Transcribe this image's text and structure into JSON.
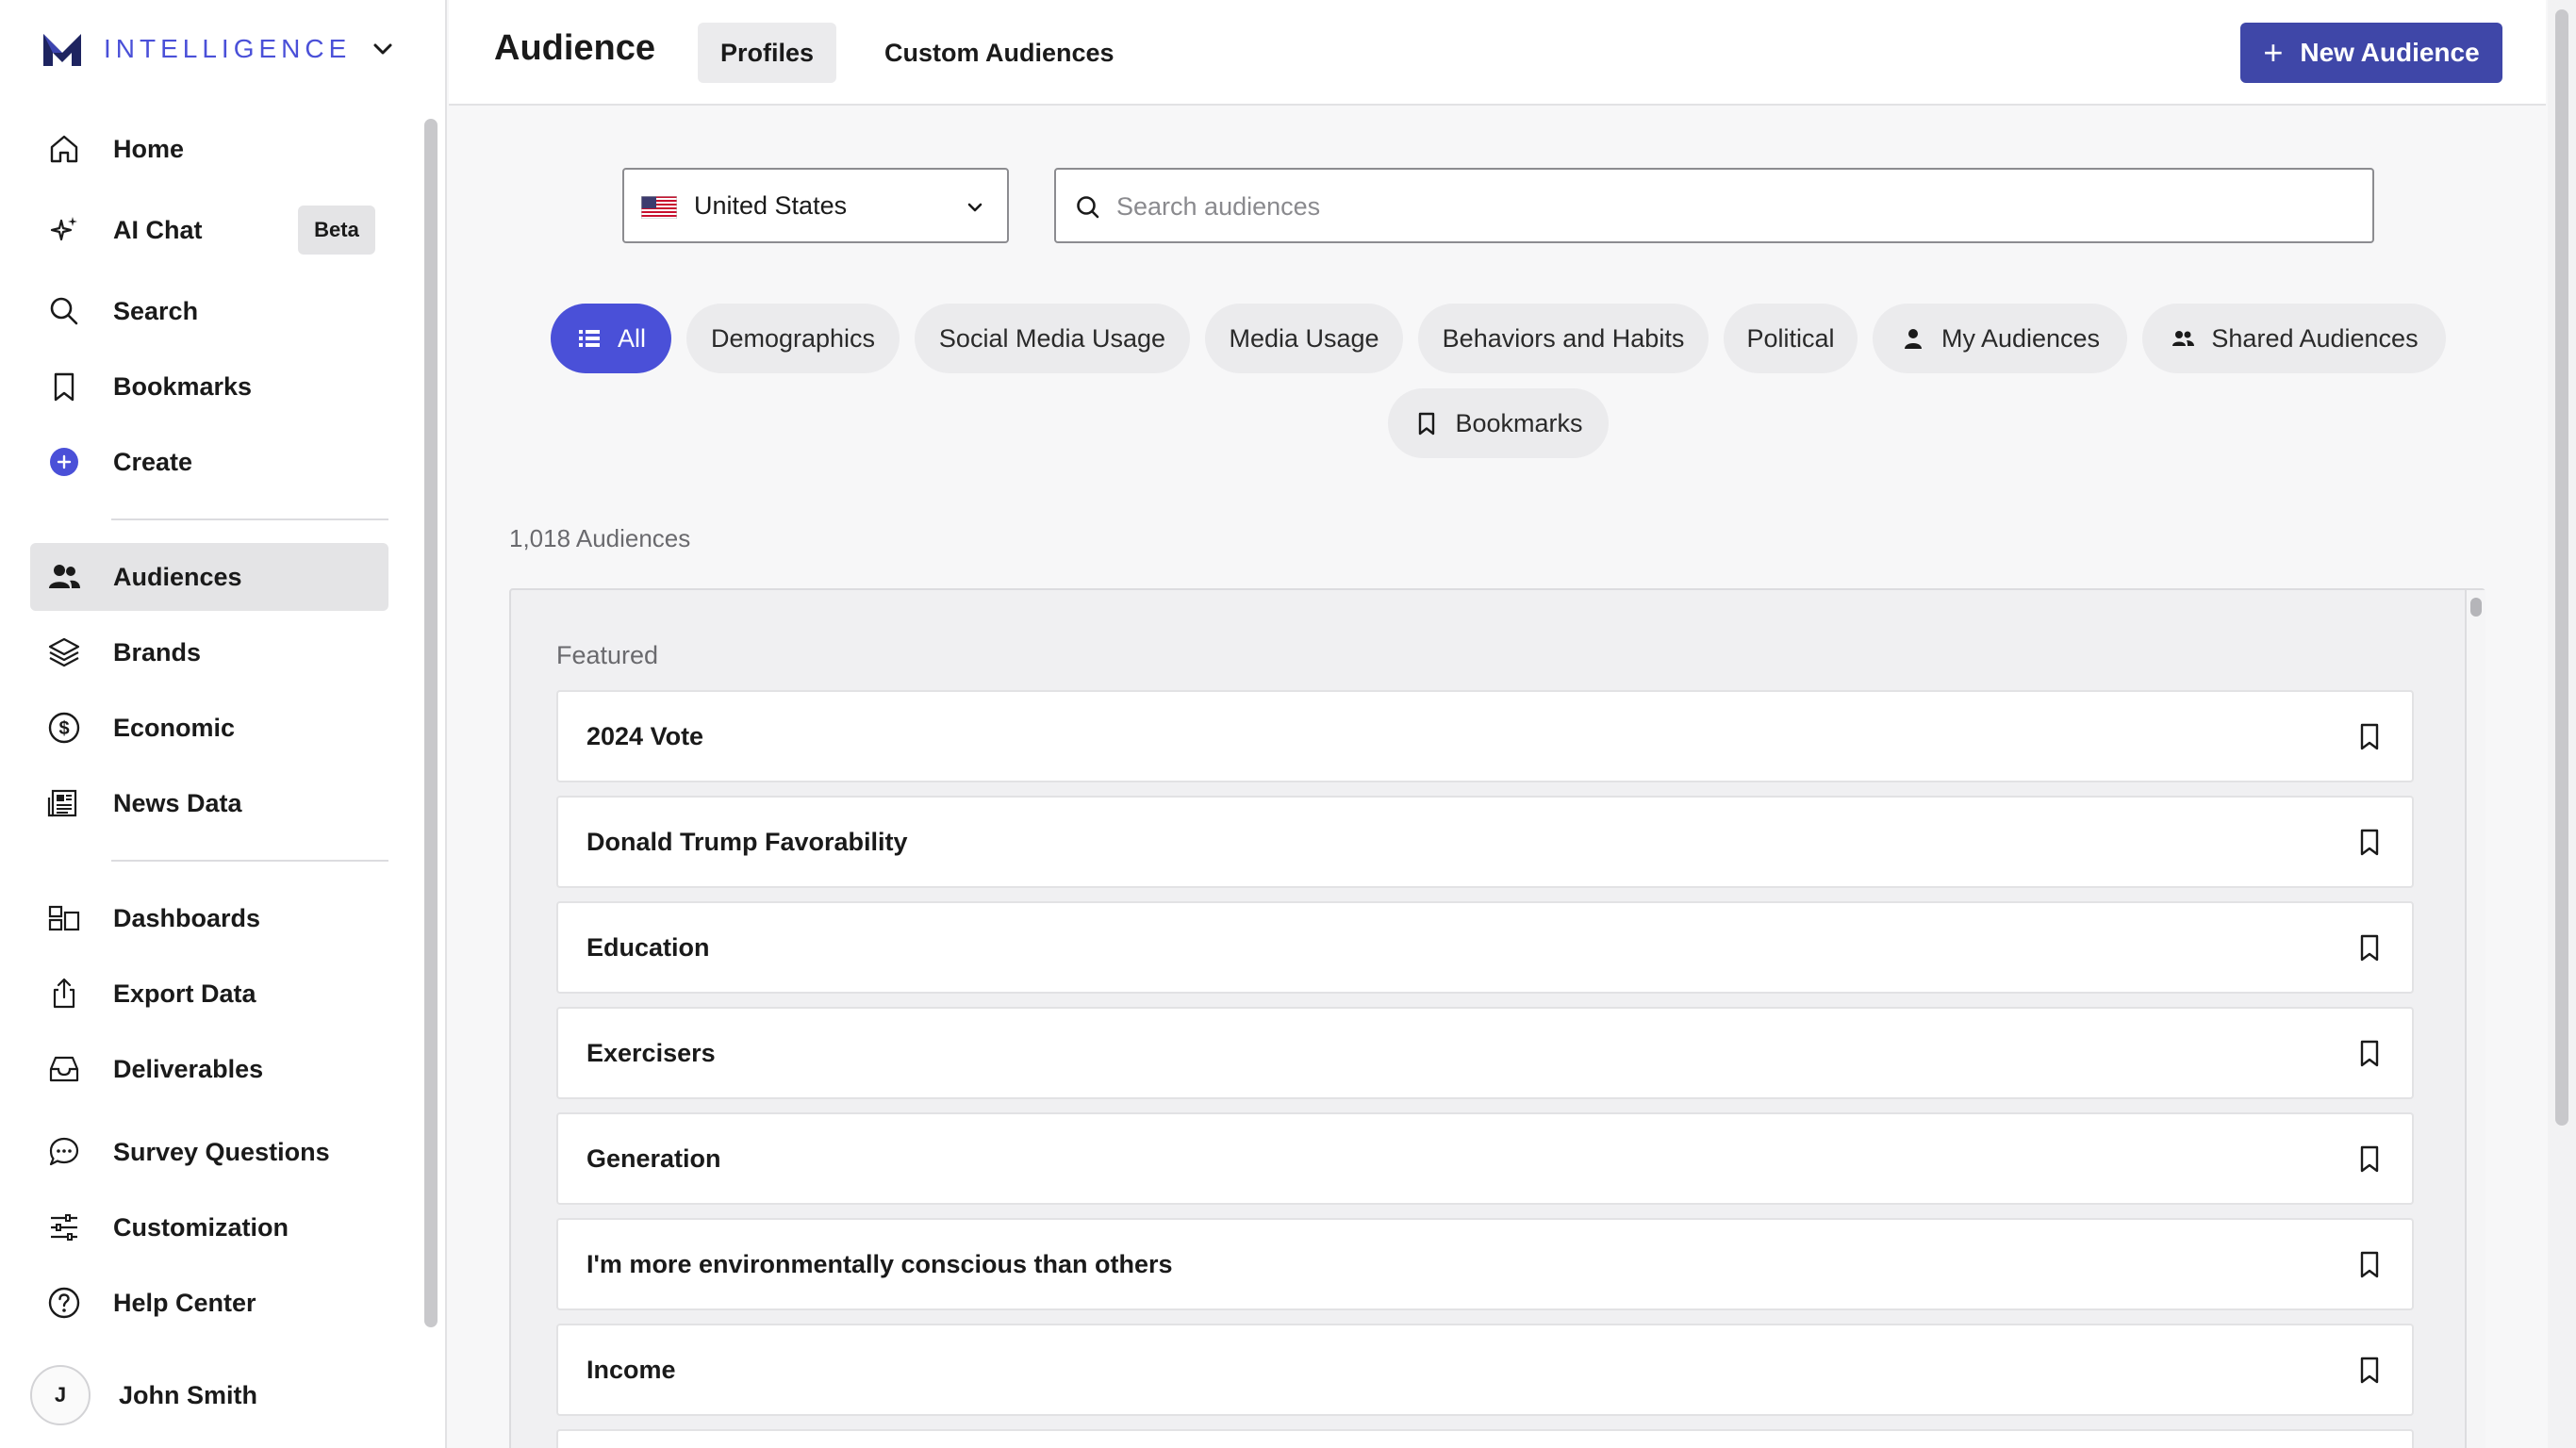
{
  "brand": {
    "name": "INTELLIGENCE"
  },
  "sidebar": {
    "items": [
      {
        "label": "Home",
        "icon": "home-icon"
      },
      {
        "label": "AI Chat",
        "icon": "sparkle-icon",
        "badge": "Beta"
      },
      {
        "label": "Search",
        "icon": "search-icon"
      },
      {
        "label": "Bookmarks",
        "icon": "bookmark-icon"
      },
      {
        "label": "Create",
        "icon": "plus-circle-icon"
      },
      {
        "label": "Audiences",
        "icon": "users-icon",
        "active": true
      },
      {
        "label": "Brands",
        "icon": "layers-icon"
      },
      {
        "label": "Economic",
        "icon": "dollar-icon"
      },
      {
        "label": "News Data",
        "icon": "newspaper-icon"
      },
      {
        "label": "Dashboards",
        "icon": "dashboard-icon"
      },
      {
        "label": "Export Data",
        "icon": "export-icon"
      },
      {
        "label": "Deliverables",
        "icon": "inbox-icon"
      },
      {
        "label": "Survey Questions",
        "icon": "chat-bubble-icon"
      },
      {
        "label": "Customization",
        "icon": "sliders-icon"
      },
      {
        "label": "Help Center",
        "icon": "help-icon"
      }
    ],
    "user": {
      "initial": "J",
      "name": "John Smith"
    }
  },
  "header": {
    "title": "Audience",
    "tabs": [
      {
        "label": "Profiles",
        "active": true
      },
      {
        "label": "Custom Audiences"
      }
    ],
    "new_button": "New Audience"
  },
  "filters": {
    "country": "United States",
    "search_placeholder": "Search audiences",
    "chips": [
      {
        "label": "All",
        "active": true
      },
      {
        "label": "Demographics"
      },
      {
        "label": "Social Media Usage"
      },
      {
        "label": "Media Usage"
      },
      {
        "label": "Behaviors and Habits"
      },
      {
        "label": "Political"
      },
      {
        "label": "My Audiences"
      },
      {
        "label": "Shared Audiences"
      },
      {
        "label": "Bookmarks"
      }
    ]
  },
  "results": {
    "count": "1,018 Audiences",
    "section_title": "Featured",
    "items": [
      "2024 Vote",
      "Donald Trump Favorability",
      "Education",
      "Exercisers",
      "Generation",
      "I'm more environmentally conscious than others",
      "Income"
    ]
  },
  "colors": {
    "accent": "#4a50d8",
    "primary_button": "#3f47a8"
  }
}
